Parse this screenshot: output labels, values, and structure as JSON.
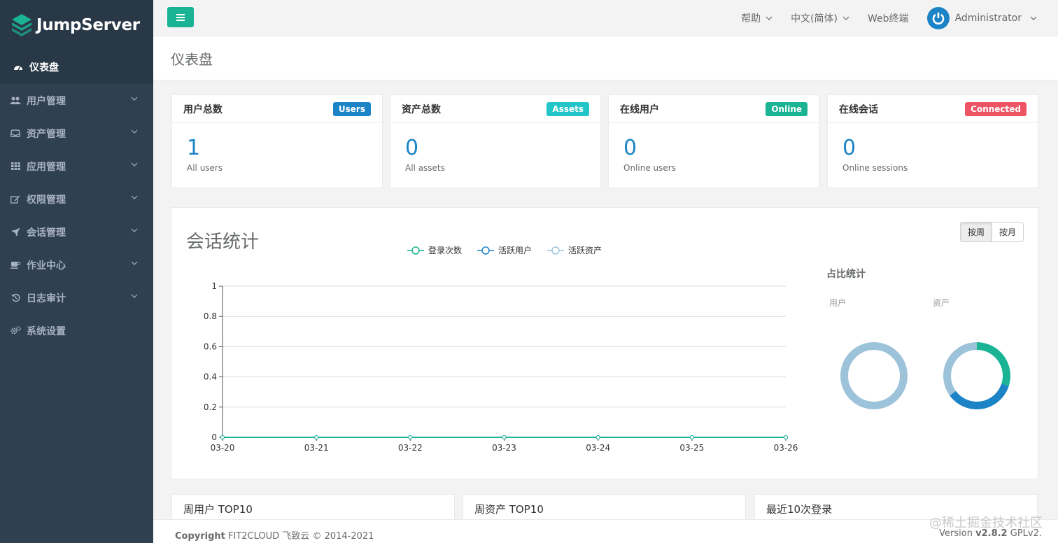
{
  "brand": {
    "name": "JumpServer"
  },
  "sidebar": {
    "items": [
      {
        "label": "仪表盘",
        "icon": "dashboard-icon",
        "active": true
      },
      {
        "label": "用户管理",
        "icon": "users-icon"
      },
      {
        "label": "资产管理",
        "icon": "inbox-icon"
      },
      {
        "label": "应用管理",
        "icon": "grid-icon"
      },
      {
        "label": "权限管理",
        "icon": "edit-icon"
      },
      {
        "label": "会话管理",
        "icon": "rocket-icon"
      },
      {
        "label": "作业中心",
        "icon": "coffee-icon"
      },
      {
        "label": "日志审计",
        "icon": "history-icon"
      },
      {
        "label": "系统设置",
        "icon": "gears-icon"
      }
    ]
  },
  "topbar": {
    "help": "帮助",
    "language": "中文(简体)",
    "web_terminal": "Web终端",
    "user": "Administrator"
  },
  "page": {
    "title": "仪表盘"
  },
  "cards": [
    {
      "title": "用户总数",
      "badge": "Users",
      "badge_color": "#1c84c6",
      "value": "1",
      "sub": "All users"
    },
    {
      "title": "资产总数",
      "badge": "Assets",
      "badge_color": "#23c6c8",
      "value": "0",
      "sub": "All assets"
    },
    {
      "title": "在线用户",
      "badge": "Online",
      "badge_color": "#1ab394",
      "value": "0",
      "sub": "Online users"
    },
    {
      "title": "在线会话",
      "badge": "Connected",
      "badge_color": "#ed5565",
      "value": "0",
      "sub": "Online sessions"
    }
  ],
  "session_panel": {
    "title": "会话统计",
    "toggle": [
      "按周",
      "按月"
    ],
    "share_title": "占比统计",
    "pie_labels": [
      "用户",
      "资产"
    ]
  },
  "chart_data": [
    {
      "type": "line",
      "title": "",
      "x": [
        "03-20",
        "03-21",
        "03-22",
        "03-23",
        "03-24",
        "03-25",
        "03-26"
      ],
      "yticks": [
        "0",
        "0.2",
        "0.4",
        "0.6",
        "0.8",
        "1"
      ],
      "ylim": [
        0,
        1
      ],
      "grid": true,
      "legend": "top",
      "series": [
        {
          "name": "登录次数",
          "values": [
            0,
            0,
            0,
            0,
            0,
            0,
            0
          ],
          "color": "#1ab394"
        },
        {
          "name": "活跃用户",
          "values": [
            0,
            0,
            0,
            0,
            0,
            0,
            0
          ],
          "color": "#1c84c6"
        },
        {
          "name": "活跃资产",
          "values": [
            0,
            0,
            0,
            0,
            0,
            0,
            0
          ],
          "color": "#9cc3da"
        }
      ]
    },
    {
      "type": "pie",
      "title": "用户",
      "slices": [
        {
          "value": 1,
          "color": "#9cc3da"
        }
      ]
    },
    {
      "type": "pie",
      "title": "资产",
      "slices": [
        {
          "value": 0.3,
          "color": "#1ab394"
        },
        {
          "value": 0.35,
          "color": "#1c84c6"
        },
        {
          "value": 0.35,
          "color": "#9cc3da"
        }
      ]
    }
  ],
  "bottom_panels": [
    "周用户 TOP10",
    "周资产 TOP10",
    "最近10次登录"
  ],
  "footer": {
    "copyright_bold": "Copyright",
    "copyright_rest": " FIT2CLOUD 飞致云 © 2014-2021",
    "version_label": "Version ",
    "version": "v2.8.2",
    "license": " GPLv2."
  },
  "watermark": "@稀土掘金技术社区"
}
